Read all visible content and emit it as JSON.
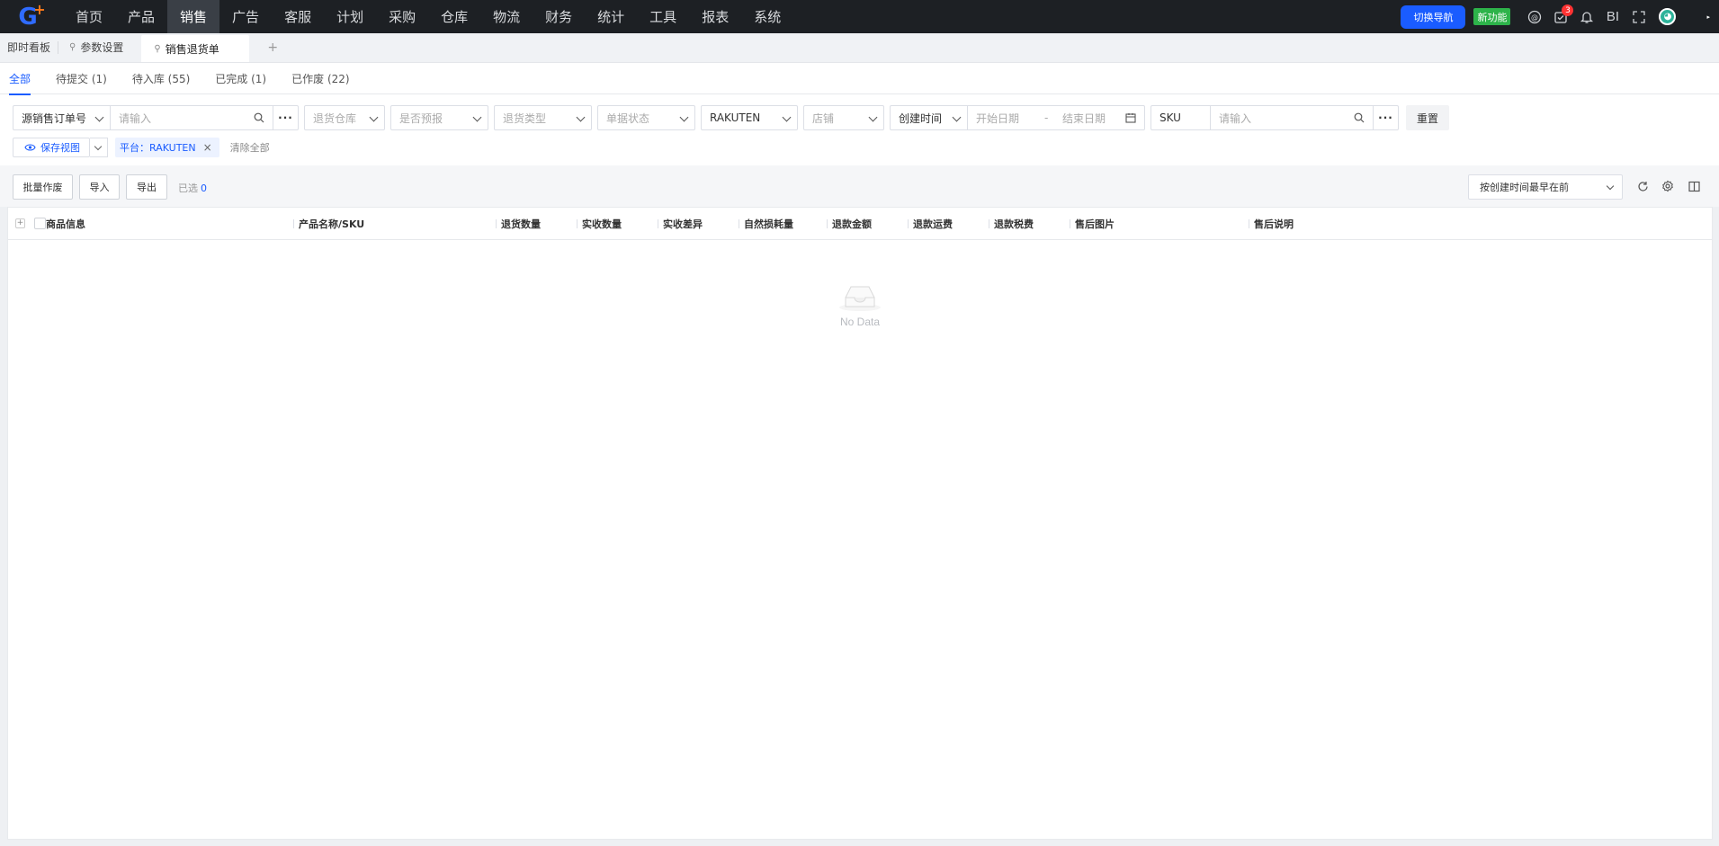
{
  "nav": {
    "items": [
      "首页",
      "产品",
      "销售",
      "广告",
      "客服",
      "计划",
      "采购",
      "仓库",
      "物流",
      "财务",
      "统计",
      "工具",
      "报表",
      "系统"
    ],
    "active_index": 2,
    "switch_nav": "切换导航",
    "new_feature": "新功能",
    "task_badge": "3",
    "bi_label": "BI"
  },
  "tabs": {
    "dashboard": "即时看板",
    "params": "参数设置",
    "active": "销售退货单",
    "add": "+"
  },
  "status_tabs": [
    "全部",
    "待提交 (1)",
    "待入库 (55)",
    "已完成 (1)",
    "已作废 (22)"
  ],
  "filters": {
    "order_type": "源销售订单号",
    "order_input_ph": "请输入",
    "warehouse_ph": "退货仓库",
    "forecast_ph": "是否预报",
    "return_type_ph": "退货类型",
    "doc_status_ph": "单据状态",
    "platform": "RAKUTEN",
    "shop_ph": "店铺",
    "time_type": "创建时间",
    "start_ph": "开始日期",
    "range_sep": "-",
    "end_ph": "结束日期",
    "sku_type": "SKU",
    "sku_input_ph": "请输入",
    "reset": "重置"
  },
  "filter_row2": {
    "save_view": "保存视图",
    "chip": "平台：RAKUTEN",
    "clear_all": "清除全部"
  },
  "toolbar": {
    "batch_void": "批量作废",
    "import": "导入",
    "export": "导出",
    "selected_label": "已选",
    "selected_count": "0",
    "sort": "按创建时间最早在前"
  },
  "table": {
    "columns": [
      "商品信息",
      "产品名称/SKU",
      "退货数量",
      "实收数量",
      "实收差异",
      "自然损耗量",
      "退款金额",
      "退款运费",
      "退款税费",
      "售后图片",
      "售后说明"
    ],
    "empty_text": "No Data"
  }
}
